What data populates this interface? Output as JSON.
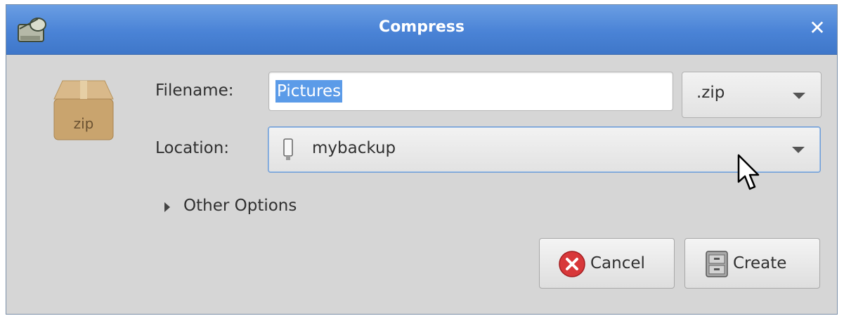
{
  "window": {
    "title": "Compress",
    "close_label": "✕"
  },
  "archive_icon": {
    "label": "zip"
  },
  "filename": {
    "label": "Filename:",
    "value": "Pictures",
    "extension": ".zip"
  },
  "location": {
    "label": "Location:",
    "value": "mybackup",
    "icon": "usb-drive-icon"
  },
  "other_options": {
    "label": "Other Options"
  },
  "buttons": {
    "cancel": "Cancel",
    "create": "Create"
  },
  "colors": {
    "titlebar": "#4a83d6",
    "selection": "#5b9be8",
    "dialog_bg": "#d6d6d6"
  }
}
